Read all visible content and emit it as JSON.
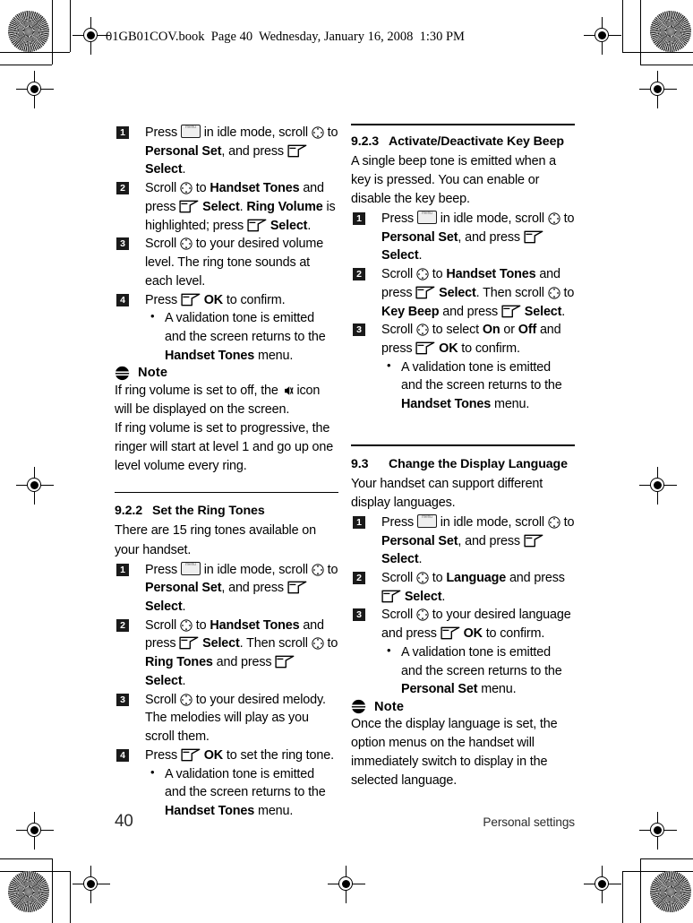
{
  "header": {
    "text": "01GB01COV.book  Page 40  Wednesday, January 16, 2008  1:30 PM"
  },
  "footer": {
    "page_number": "40",
    "running_title": "Personal settings"
  },
  "icons": {
    "menu_key": "menu-key-icon",
    "scroll_key": "scroll-navigation-icon",
    "soft_key": "soft-key-icon",
    "ringer_off": "ringer-off-icon",
    "note": "note-icon"
  },
  "left_column": {
    "continued_steps": [
      {
        "number": "1",
        "parts": [
          {
            "t": "text",
            "v": "Press "
          },
          {
            "t": "icon",
            "v": "menu"
          },
          {
            "t": "text",
            "v": " in idle mode, scroll "
          },
          {
            "t": "icon",
            "v": "scroll"
          },
          {
            "t": "text",
            "v": " to "
          },
          {
            "t": "bold",
            "v": "Personal Set"
          },
          {
            "t": "text",
            "v": ", and press "
          },
          {
            "t": "icon",
            "v": "soft"
          },
          {
            "t": "text",
            "v": " "
          },
          {
            "t": "bold",
            "v": "Select"
          },
          {
            "t": "text",
            "v": "."
          }
        ]
      },
      {
        "number": "2",
        "parts": [
          {
            "t": "text",
            "v": "Scroll "
          },
          {
            "t": "icon",
            "v": "scroll"
          },
          {
            "t": "text",
            "v": " to "
          },
          {
            "t": "bold",
            "v": "Handset Tones"
          },
          {
            "t": "text",
            "v": " and press "
          },
          {
            "t": "icon",
            "v": "soft"
          },
          {
            "t": "text",
            "v": " "
          },
          {
            "t": "bold",
            "v": "Select"
          },
          {
            "t": "text",
            "v": ". "
          },
          {
            "t": "bold",
            "v": "Ring Volume"
          },
          {
            "t": "text",
            "v": " is highlighted; press "
          },
          {
            "t": "icon",
            "v": "soft"
          },
          {
            "t": "text",
            "v": " "
          },
          {
            "t": "bold",
            "v": "Select"
          },
          {
            "t": "text",
            "v": "."
          }
        ]
      },
      {
        "number": "3",
        "parts": [
          {
            "t": "text",
            "v": "Scroll "
          },
          {
            "t": "icon",
            "v": "scroll"
          },
          {
            "t": "text",
            "v": " to your desired volume level. The ring tone sounds at each level."
          }
        ]
      },
      {
        "number": "4",
        "parts": [
          {
            "t": "text",
            "v": "Press "
          },
          {
            "t": "icon",
            "v": "soft"
          },
          {
            "t": "text",
            "v": " "
          },
          {
            "t": "bold",
            "v": "OK"
          },
          {
            "t": "text",
            "v": " to confirm."
          }
        ],
        "bullets": [
          [
            {
              "t": "text",
              "v": "A validation tone is emitted and the screen returns to the "
            },
            {
              "t": "bold",
              "v": "Handset Tones"
            },
            {
              "t": "text",
              "v": " menu."
            }
          ]
        ]
      }
    ],
    "note": {
      "label": "Note",
      "paragraphs": [
        [
          {
            "t": "text",
            "v": "If ring volume is set to off, the "
          },
          {
            "t": "icon",
            "v": "ringoff"
          },
          {
            "t": "text",
            "v": " icon will be displayed on the screen."
          }
        ],
        [
          {
            "t": "text",
            "v": "If ring volume is set to progressive, the ringer will start at level 1 and go up one level volume every ring."
          }
        ]
      ]
    },
    "section": {
      "number": "9.2.2",
      "title": "Set the Ring Tones",
      "intro": "There are 15 ring tones available on your handset.",
      "steps": [
        {
          "number": "1",
          "parts": [
            {
              "t": "text",
              "v": "Press "
            },
            {
              "t": "icon",
              "v": "menu"
            },
            {
              "t": "text",
              "v": " in idle mode, scroll "
            },
            {
              "t": "icon",
              "v": "scroll"
            },
            {
              "t": "text",
              "v": " to "
            },
            {
              "t": "bold",
              "v": "Personal Set"
            },
            {
              "t": "text",
              "v": ", and press "
            },
            {
              "t": "icon",
              "v": "soft"
            },
            {
              "t": "text",
              "v": " "
            },
            {
              "t": "bold",
              "v": "Select"
            },
            {
              "t": "text",
              "v": "."
            }
          ]
        },
        {
          "number": "2",
          "parts": [
            {
              "t": "text",
              "v": "Scroll "
            },
            {
              "t": "icon",
              "v": "scroll"
            },
            {
              "t": "text",
              "v": " to "
            },
            {
              "t": "bold",
              "v": "Handset Tones"
            },
            {
              "t": "text",
              "v": " and press "
            },
            {
              "t": "icon",
              "v": "soft"
            },
            {
              "t": "text",
              "v": " "
            },
            {
              "t": "bold",
              "v": "Select"
            },
            {
              "t": "text",
              "v": ". Then scroll "
            },
            {
              "t": "icon",
              "v": "scroll"
            },
            {
              "t": "text",
              "v": " to "
            },
            {
              "t": "bold",
              "v": "Ring Tones"
            },
            {
              "t": "text",
              "v": " and press "
            },
            {
              "t": "icon",
              "v": "soft"
            },
            {
              "t": "text",
              "v": " "
            },
            {
              "t": "bold",
              "v": "Select"
            },
            {
              "t": "text",
              "v": "."
            }
          ]
        },
        {
          "number": "3",
          "parts": [
            {
              "t": "text",
              "v": "Scroll "
            },
            {
              "t": "icon",
              "v": "scroll"
            },
            {
              "t": "text",
              "v": " to your desired melody. The melodies will play as you scroll them."
            }
          ]
        },
        {
          "number": "4",
          "parts": [
            {
              "t": "text",
              "v": "Press "
            },
            {
              "t": "icon",
              "v": "soft"
            },
            {
              "t": "text",
              "v": " "
            },
            {
              "t": "bold",
              "v": "OK"
            },
            {
              "t": "text",
              "v": " to set the ring tone."
            }
          ],
          "bullets": [
            [
              {
                "t": "text",
                "v": "A validation tone is emitted and the screen returns to the "
              },
              {
                "t": "bold",
                "v": "Handset Tones"
              },
              {
                "t": "text",
                "v": " menu."
              }
            ]
          ]
        }
      ]
    }
  },
  "right_column": {
    "section_923": {
      "number": "9.2.3",
      "title": "Activate/Deactivate Key Beep",
      "intro": "A single beep tone is emitted when a key is pressed. You can enable or disable the key beep.",
      "steps": [
        {
          "number": "1",
          "parts": [
            {
              "t": "text",
              "v": "Press "
            },
            {
              "t": "icon",
              "v": "menu"
            },
            {
              "t": "text",
              "v": " in idle mode, scroll "
            },
            {
              "t": "icon",
              "v": "scroll"
            },
            {
              "t": "text",
              "v": " to "
            },
            {
              "t": "bold",
              "v": "Personal Set"
            },
            {
              "t": "text",
              "v": ", and press "
            },
            {
              "t": "icon",
              "v": "soft"
            },
            {
              "t": "text",
              "v": " "
            },
            {
              "t": "bold",
              "v": "Select"
            },
            {
              "t": "text",
              "v": "."
            }
          ]
        },
        {
          "number": "2",
          "parts": [
            {
              "t": "text",
              "v": "Scroll "
            },
            {
              "t": "icon",
              "v": "scroll"
            },
            {
              "t": "text",
              "v": " to "
            },
            {
              "t": "bold",
              "v": "Handset Tones"
            },
            {
              "t": "text",
              "v": " and press "
            },
            {
              "t": "icon",
              "v": "soft"
            },
            {
              "t": "text",
              "v": " "
            },
            {
              "t": "bold",
              "v": "Select"
            },
            {
              "t": "text",
              "v": ". Then scroll "
            },
            {
              "t": "icon",
              "v": "scroll"
            },
            {
              "t": "text",
              "v": " to "
            },
            {
              "t": "bold",
              "v": "Key Beep"
            },
            {
              "t": "text",
              "v": " and press "
            },
            {
              "t": "icon",
              "v": "soft"
            },
            {
              "t": "text",
              "v": " "
            },
            {
              "t": "bold",
              "v": "Select"
            },
            {
              "t": "text",
              "v": "."
            }
          ]
        },
        {
          "number": "3",
          "parts": [
            {
              "t": "text",
              "v": "Scroll "
            },
            {
              "t": "icon",
              "v": "scroll"
            },
            {
              "t": "text",
              "v": " to select "
            },
            {
              "t": "bold",
              "v": "On"
            },
            {
              "t": "text",
              "v": " or "
            },
            {
              "t": "bold",
              "v": "Off"
            },
            {
              "t": "text",
              "v": " and press "
            },
            {
              "t": "icon",
              "v": "soft"
            },
            {
              "t": "text",
              "v": " "
            },
            {
              "t": "bold",
              "v": "OK"
            },
            {
              "t": "text",
              "v": " to confirm."
            }
          ],
          "bullets": [
            [
              {
                "t": "text",
                "v": "A validation tone is emitted and the screen returns to the "
              },
              {
                "t": "bold",
                "v": "Handset Tones"
              },
              {
                "t": "text",
                "v": " menu."
              }
            ]
          ]
        }
      ]
    },
    "section_93": {
      "number": "9.3",
      "title": "Change the Display Language",
      "intro": "Your handset can support different display languages.",
      "steps": [
        {
          "number": "1",
          "parts": [
            {
              "t": "text",
              "v": "Press "
            },
            {
              "t": "icon",
              "v": "menu"
            },
            {
              "t": "text",
              "v": " in idle mode, scroll "
            },
            {
              "t": "icon",
              "v": "scroll"
            },
            {
              "t": "text",
              "v": " to "
            },
            {
              "t": "bold",
              "v": "Personal Set"
            },
            {
              "t": "text",
              "v": ", and press "
            },
            {
              "t": "icon",
              "v": "soft"
            },
            {
              "t": "text",
              "v": " "
            },
            {
              "t": "bold",
              "v": "Select"
            },
            {
              "t": "text",
              "v": "."
            }
          ]
        },
        {
          "number": "2",
          "parts": [
            {
              "t": "text",
              "v": "Scroll "
            },
            {
              "t": "icon",
              "v": "scroll"
            },
            {
              "t": "text",
              "v": " to "
            },
            {
              "t": "bold",
              "v": "Language"
            },
            {
              "t": "text",
              "v": " and press "
            },
            {
              "t": "icon",
              "v": "soft"
            },
            {
              "t": "text",
              "v": " "
            },
            {
              "t": "bold",
              "v": "Select"
            },
            {
              "t": "text",
              "v": "."
            }
          ]
        },
        {
          "number": "3",
          "parts": [
            {
              "t": "text",
              "v": "Scroll "
            },
            {
              "t": "icon",
              "v": "scroll"
            },
            {
              "t": "text",
              "v": " to your desired language and press "
            },
            {
              "t": "icon",
              "v": "soft"
            },
            {
              "t": "text",
              "v": " "
            },
            {
              "t": "bold",
              "v": "OK"
            },
            {
              "t": "text",
              "v": " to confirm."
            }
          ],
          "bullets": [
            [
              {
                "t": "text",
                "v": "A validation tone is emitted and the screen returns to the "
              },
              {
                "t": "bold",
                "v": "Personal Set"
              },
              {
                "t": "text",
                "v": " menu."
              }
            ]
          ]
        }
      ]
    },
    "note": {
      "label": "Note",
      "paragraphs": [
        [
          {
            "t": "text",
            "v": "Once the display language is set, the option menus on the handset will immediately switch to display in the selected language."
          }
        ]
      ]
    }
  }
}
